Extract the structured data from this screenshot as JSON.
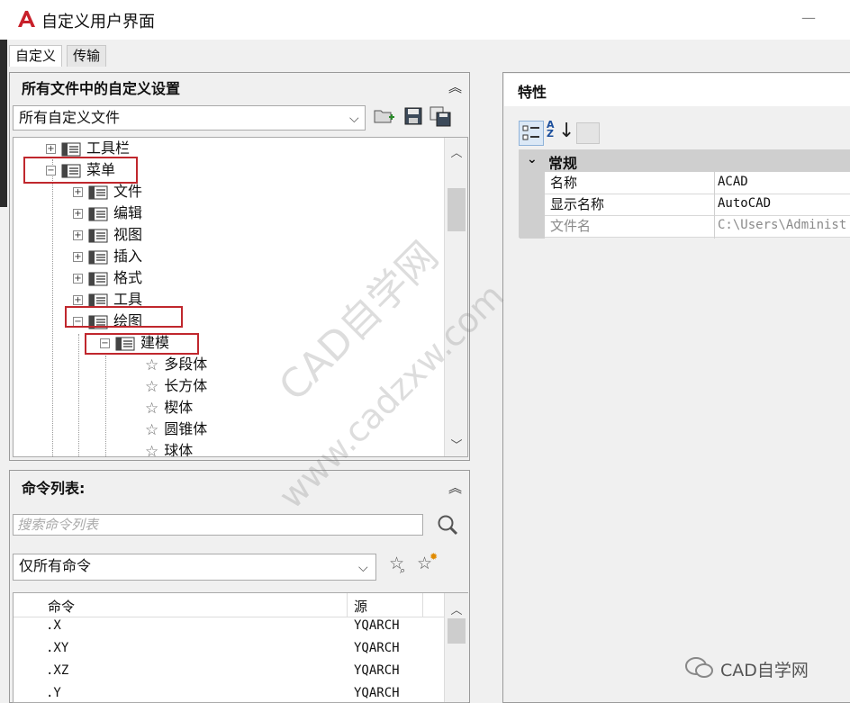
{
  "window": {
    "title": "自定义用户界面",
    "min_glyph": "—"
  },
  "tabs": [
    "自定义",
    "传输"
  ],
  "customizations_panel": {
    "header": "所有文件中的自定义设置",
    "file_filter": "所有自定义文件",
    "toolbar_icons": [
      "open-folder-icon",
      "save-icon",
      "save-as-icon"
    ],
    "tree": [
      {
        "label": "工具栏",
        "level": 1,
        "expander": "+",
        "icon": "toolbar-icon"
      },
      {
        "label": "菜单",
        "level": 1,
        "expander": "−",
        "icon": "menu-icon",
        "highlighted": true
      },
      {
        "label": "文件",
        "level": 2,
        "expander": "+",
        "icon": "menu-icon"
      },
      {
        "label": "编辑",
        "level": 2,
        "expander": "+",
        "icon": "menu-icon"
      },
      {
        "label": "视图",
        "level": 2,
        "expander": "+",
        "icon": "menu-icon"
      },
      {
        "label": "插入",
        "level": 2,
        "expander": "+",
        "icon": "menu-icon"
      },
      {
        "label": "格式",
        "level": 2,
        "expander": "+",
        "icon": "menu-icon"
      },
      {
        "label": "工具",
        "level": 2,
        "expander": "+",
        "icon": "menu-icon"
      },
      {
        "label": "绘图",
        "level": 2,
        "expander": "−",
        "icon": "menu-icon",
        "highlighted": true
      },
      {
        "label": "建模",
        "level": 3,
        "expander": "−",
        "icon": "menu-icon",
        "highlighted": true
      },
      {
        "label": "多段体",
        "level": 4,
        "icon": "star-icon"
      },
      {
        "label": "长方体",
        "level": 4,
        "icon": "star-icon"
      },
      {
        "label": "楔体",
        "level": 4,
        "icon": "star-icon"
      },
      {
        "label": "圆锥体",
        "level": 4,
        "icon": "star-icon"
      },
      {
        "label": "球体",
        "level": 4,
        "icon": "star-icon"
      }
    ]
  },
  "command_panel": {
    "header": "命令列表:",
    "search_placeholder": "搜索命令列表",
    "filter": "仅所有命令",
    "columns": [
      "命令",
      "源"
    ],
    "rows": [
      {
        "command": ".X",
        "source": "YQARCH"
      },
      {
        "command": ".XY",
        "source": "YQARCH"
      },
      {
        "command": ".XZ",
        "source": "YQARCH"
      },
      {
        "command": ".Y",
        "source": "YQARCH"
      }
    ]
  },
  "properties_panel": {
    "header": "特性",
    "category": "常规",
    "rows": [
      {
        "name": "名称",
        "value": "ACAD",
        "disabled": false
      },
      {
        "name": "显示名称",
        "value": "AutoCAD",
        "disabled": false
      },
      {
        "name": "文件名",
        "value": "C:\\Users\\Administ",
        "disabled": true
      }
    ]
  },
  "watermarks": {
    "main": "CAD自学网",
    "url": "www.cadzxw.com"
  },
  "wechat_badge": "CAD自学网",
  "colors": {
    "highlight_box": "#c0272d",
    "logo_red": "#c8202a"
  }
}
